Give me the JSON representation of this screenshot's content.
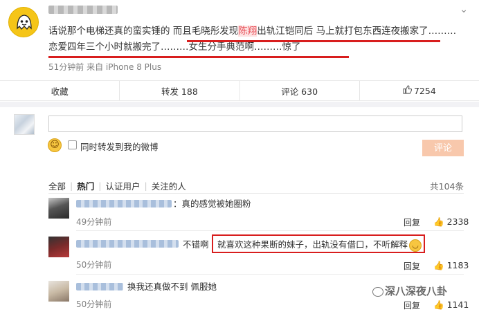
{
  "post": {
    "text_before": "话说那个电梯还真的蛮实锤的 而且毛晓彤发现",
    "highlight_name": "陈翔",
    "text_after": "出轨江铠同后 马上就打包东西连夜搬家了………恋爱四年三个小时就搬完了………女生分手典范啊………惊了",
    "meta": "51分钟前 来自 iPhone 8 Plus",
    "arrow": "⌄"
  },
  "actions": {
    "collect": "收藏",
    "repost": "转发 188",
    "comment": "评论 630",
    "like": "7254",
    "like_icon": "thumbs-up-icon"
  },
  "composer": {
    "input_value": "",
    "input_placeholder": "",
    "forward_label": "同时转发到我的微博",
    "submit": "评论",
    "emoji": "☺"
  },
  "tabs": {
    "items": [
      "全部",
      "热门",
      "认证用户",
      "关注的人"
    ],
    "active": "热门",
    "total": "共104条"
  },
  "comments": [
    {
      "text": "：真的感觉被她圈粉",
      "time": "49分钟前",
      "reply": "回复",
      "likes": "2338"
    },
    {
      "text_prefix": "不错啊",
      "text": "就喜欢这种果断的妹子，出轨没有借口，不听解释",
      "time": "50分钟前",
      "reply": "回复",
      "likes": "1183"
    },
    {
      "text": "换我还真做不到 佩服她",
      "time": "50分钟前",
      "reply": "回复",
      "likes": "1141"
    }
  ],
  "watermark": "深八深夜八卦",
  "colors": {
    "accent_red": "#d81e1e",
    "submit_bg": "#f8c8ac",
    "highlight": "#e8555d"
  }
}
